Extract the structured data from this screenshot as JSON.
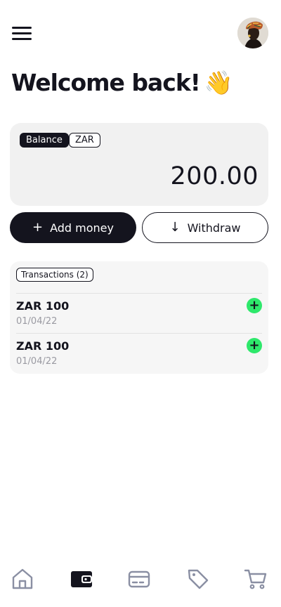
{
  "header": {
    "menu_icon": "hamburger-menu-icon",
    "avatar_icon": "user-avatar"
  },
  "welcome": {
    "title": "Welcome back!",
    "emoji": "👋"
  },
  "balance": {
    "label_chip": "Balance",
    "currency_chip": "ZAR",
    "amount": "200.00"
  },
  "actions": {
    "add_money": {
      "label": "Add money",
      "icon": "plus-icon"
    },
    "withdraw": {
      "label": "Withdraw",
      "icon": "arrow-down-icon"
    }
  },
  "transactions": {
    "header_label": "Transactions (2)",
    "items": [
      {
        "amount": "ZAR 100",
        "date": "01/04/22",
        "type_icon": "plus-circle-icon"
      },
      {
        "amount": "ZAR 100",
        "date": "01/04/22",
        "type_icon": "plus-circle-icon"
      }
    ]
  },
  "bottom_nav": {
    "items": [
      {
        "icon": "home-icon",
        "active": false
      },
      {
        "icon": "wallet-icon",
        "active": true
      },
      {
        "icon": "card-icon",
        "active": false
      },
      {
        "icon": "tag-icon",
        "active": false
      },
      {
        "icon": "cart-icon",
        "active": false
      }
    ]
  },
  "colors": {
    "primary": "#14141e",
    "accent_green": "#2ee86b",
    "card_bg": "#f1f1f1",
    "muted_text": "#9a9aa2",
    "nav_inactive": "#8a8fa3"
  }
}
